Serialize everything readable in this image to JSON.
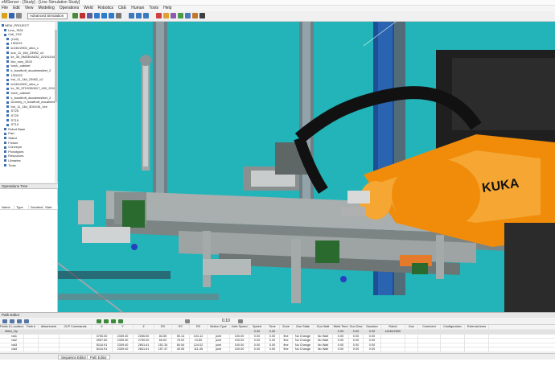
{
  "window": {
    "title": "eMServer - [Study] - [Line Simulation Study]"
  },
  "menu": [
    "File",
    "Edit",
    "View",
    "Modeling",
    "Operations",
    "Weld",
    "Robotics",
    "CEE",
    "Human",
    "Tools",
    "Help"
  ],
  "toolbar": {
    "mode": "Advanced Simulation"
  },
  "tree": {
    "rows": [
      "NEW_PROJECT",
      "  Line_7831",
      "  Cell_7H2",
      "    (Cell)",
      "    1SD021",
      "    kr240r2900_ultra_c",
      "    kux_11_1lld_23952_c2",
      "    kx_30_5M33HA532_20191016",
      "    kkx_cwu_3520",
      "    torch_cabinet",
      "    k_bowlfroft_ducalmeshtet_2",
      "    1SD022",
      "    bol_11_1lld_23952_c2",
      "    kr240r2900_ultra_c",
      "    kx_30_5TK0330817_400_20150821",
      "    torch_cabinet",
      "    k_bowlfroft_ducalmeshtet_2",
      "    Dummy_n_bowlfroft_ducalmeshtet",
      "    bol_11_1lld_3D0108_1ee",
      "    ST25",
      "    ST20",
      "    ST15",
      "    ST10",
      "  Robot Base",
      "  Part",
      "  Stand",
      "  Fixture",
      "  Conveyor",
      "  Prototypes",
      "  Resources",
      "  Libraries",
      "  Tools"
    ]
  },
  "operations": {
    "title": "Operations Tree",
    "columns": [
      "Name",
      "Type",
      "Duration",
      "Start"
    ]
  },
  "path_editor": {
    "title": "Path Editor",
    "speed": "0.10",
    "columns": [
      "Paths & Locations",
      "Path #",
      "Attachment",
      "OLP Commands",
      "X",
      "Y",
      "Z",
      "RX",
      "RY",
      "RZ",
      "Motion Type",
      "Joint Speed",
      "Speed",
      "Time",
      "Zone",
      "Gun State",
      "Gun Wait",
      "Weld Time",
      "Gun Dew",
      "Duration",
      "Robot",
      "Gun",
      "Comment",
      "Configuration",
      "External Axes"
    ],
    "rows": [
      [
        "Weld_Op",
        "",
        "",
        "",
        "",
        "",
        "",
        "",
        "",
        "",
        "",
        "",
        "0.00",
        "0.00",
        "",
        "",
        "",
        "0.00",
        "0.00",
        "0.00",
        "kr240r2900",
        "",
        "",
        "",
        ""
      ],
      [
        "via1",
        "",
        "",
        "",
        "3750.00",
        "2339.40",
        "2266.50",
        "84.55",
        "50.14",
        "104.12",
        "joint",
        "100.00",
        "0.00",
        "0.00",
        "fine",
        "No Change",
        "No Wait",
        "0.00",
        "0.00",
        "0.00",
        "",
        "",
        "",
        "",
        ""
      ],
      [
        "via2",
        "",
        "",
        "",
        "3957.60",
        "2339.40",
        "2750.00",
        "65.00",
        "75.02",
        "10.80",
        "joint",
        "100.00",
        "0.00",
        "0.00",
        "fine",
        "No Change",
        "No Wait",
        "0.00",
        "0.00",
        "0.00",
        "",
        "",
        "",
        "",
        ""
      ],
      [
        "via3",
        "",
        "",
        "",
        "8116.91",
        "2339.40",
        "2841.61",
        "151.34",
        "60.54",
        "124.02",
        "joint",
        "100.00",
        "0.00",
        "0.00",
        "fine",
        "No Change",
        "No Wait",
        "0.00",
        "0.00",
        "0.00",
        "",
        "",
        "",
        "",
        ""
      ],
      [
        "via4",
        "",
        "",
        "",
        "8116.91",
        "2339.40",
        "2841.61",
        "157.47",
        "49.05",
        "111.45",
        "joint",
        "100.00",
        "0.00",
        "0.00",
        "fine",
        "No Change",
        "No Wait",
        "0.00",
        "0.00",
        "0.00",
        "",
        "",
        "",
        "",
        ""
      ]
    ],
    "tabs": [
      "Sequence Editor",
      "Path Editor"
    ]
  },
  "viewport": {
    "robot_brand": "KUKA"
  },
  "colors": {
    "viewport_bg": "#22b4b8",
    "robot": "#f08c0a",
    "accent": "#1f5fbf"
  }
}
